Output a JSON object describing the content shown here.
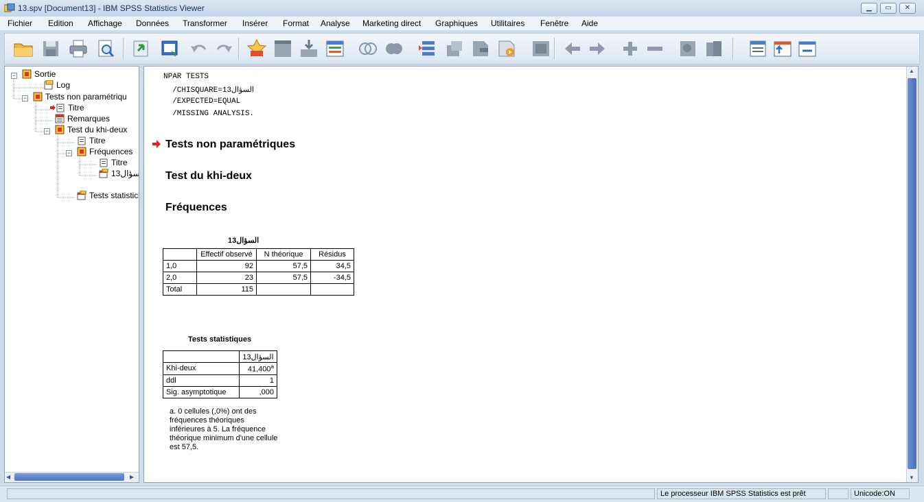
{
  "window": {
    "title": "13.spv [Document13] - IBM SPSS Statistics Viewer",
    "controls": [
      "minimize",
      "maximize",
      "close"
    ]
  },
  "menu": [
    "Fichier",
    "Edition",
    "Affichage",
    "Données",
    "Transformer",
    "Insérer",
    "Format",
    "Analyse",
    "Marketing direct",
    "Graphiques",
    "Utilitaires",
    "Fenêtre",
    "Aide"
  ],
  "toolbar": {
    "icons": [
      "open-folder-icon",
      "save-icon",
      "print-icon",
      "print-preview-icon",
      "export-icon",
      "recall-dialog-icon",
      "undo-icon",
      "redo-icon",
      "goto-data-icon",
      "goto-case-icon",
      "goto-variable-icon",
      "variables-icon",
      "show-all-icon",
      "hide-icon",
      "designated-window-icon",
      "promote-icon",
      "demote-icon",
      "expand-icon",
      "collapse-icon",
      "show-icon",
      "back-icon",
      "forward-icon",
      "plus-icon",
      "minus-icon",
      "hide-item-icon",
      "show-item-icon",
      "insert-heading-icon",
      "insert-title-icon",
      "insert-text-icon"
    ]
  },
  "tree": {
    "items": [
      {
        "label": "Sortie",
        "level": 0,
        "icon": "book-icon",
        "expander": "−"
      },
      {
        "label": "Log",
        "level": 1,
        "icon": "log-icon",
        "expander": ""
      },
      {
        "label": "Tests non paramétriqu",
        "level": 1,
        "icon": "book-icon",
        "expander": "−"
      },
      {
        "label": "Titre",
        "level": 2,
        "icon": "title-icon",
        "expander": "",
        "current": true
      },
      {
        "label": "Remarques",
        "level": 2,
        "icon": "notes-icon",
        "expander": ""
      },
      {
        "label": "Test du khi-deux",
        "level": 2,
        "icon": "book-icon",
        "expander": "−"
      },
      {
        "label": "Titre",
        "level": 3,
        "icon": "title-icon",
        "expander": ""
      },
      {
        "label": "Fréquences",
        "level": 3,
        "icon": "book-icon",
        "expander": "−"
      },
      {
        "label": "Titre",
        "level": 4,
        "icon": "title-icon",
        "expander": ""
      },
      {
        "label": "السؤال13",
        "level": 4,
        "icon": "table-icon",
        "expander": ""
      },
      {
        "label": "Tests statistic",
        "level": 3,
        "icon": "table-icon",
        "expander": ""
      }
    ]
  },
  "syntax": [
    "NPAR TESTS",
    "  /CHISQUARE=13السؤال",
    "  /EXPECTED=EQUAL",
    "  /MISSING ANALYSIS."
  ],
  "headings": {
    "main": "Tests non paramétriques",
    "sub": "Test du khi-deux",
    "freq": "Fréquences"
  },
  "freq_table": {
    "caption": "السؤال13",
    "headers": [
      "",
      "Effectif observé",
      "N théorique",
      "Résidus"
    ],
    "rows": [
      [
        "1,0",
        "92",
        "57,5",
        "34,5"
      ],
      [
        "2,0",
        "23",
        "57,5",
        "-34,5"
      ],
      [
        "Total",
        "115",
        "",
        ""
      ]
    ]
  },
  "stats_table": {
    "caption": "Tests statistiques",
    "header": "السؤال13",
    "rows": [
      [
        "Khi-deux",
        "41,400",
        "a"
      ],
      [
        "ddl",
        "1",
        ""
      ],
      [
        "Sig. asymptotique",
        ",000",
        ""
      ]
    ],
    "footnote": "a. 0 cellules (,0%) ont des fréquences théoriques inférieures à 5. La fréquence théorique minimum d'une cellule est 57,5."
  },
  "status": {
    "message": "Le processeur IBM SPSS Statistics  est prêt",
    "unicode": "Unicode:ON"
  }
}
